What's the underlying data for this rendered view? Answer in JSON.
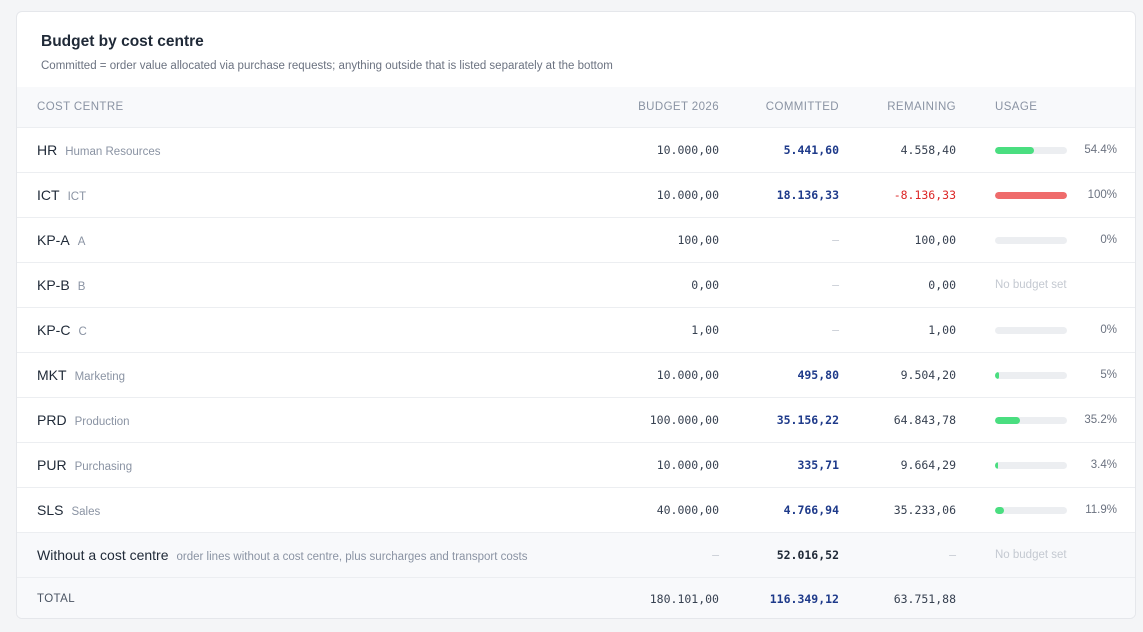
{
  "header": {
    "title": "Budget by cost centre",
    "subtitle": "Committed = order value allocated via purchase requests; anything outside that is listed separately at the bottom"
  },
  "columns": {
    "cost_centre": "COST CENTRE",
    "budget": "BUDGET 2026",
    "committed": "COMMITTED",
    "remaining": "REMAINING",
    "usage": "USAGE"
  },
  "colors": {
    "ok": "#4ade80",
    "over": "#ef6b6b",
    "track": "#eceef1"
  },
  "rows": [
    {
      "code": "HR",
      "description": "Human Resources",
      "budget": "10.000,00",
      "committed": "5.441,60",
      "remaining": "4.558,40",
      "usage_label": "54.4%",
      "usage_fraction": 0.544,
      "status": "ok"
    },
    {
      "code": "ICT",
      "description": "ICT",
      "budget": "10.000,00",
      "committed": "18.136,33",
      "remaining": "-8.136,33",
      "usage_label": "100%",
      "usage_fraction": 1.0,
      "status": "over"
    },
    {
      "code": "KP-A",
      "description": "A",
      "budget": "100,00",
      "committed": "–",
      "remaining": "100,00",
      "usage_label": "0%",
      "usage_fraction": 0.0,
      "status": "ok"
    },
    {
      "code": "KP-B",
      "description": "B",
      "budget": "0,00",
      "committed": "–",
      "remaining": "0,00",
      "usage_label": "No budget set",
      "usage_fraction": null,
      "status": "none"
    },
    {
      "code": "KP-C",
      "description": "C",
      "budget": "1,00",
      "committed": "–",
      "remaining": "1,00",
      "usage_label": "0%",
      "usage_fraction": 0.0,
      "status": "ok"
    },
    {
      "code": "MKT",
      "description": "Marketing",
      "budget": "10.000,00",
      "committed": "495,80",
      "remaining": "9.504,20",
      "usage_label": "5%",
      "usage_fraction": 0.05,
      "status": "ok"
    },
    {
      "code": "PRD",
      "description": "Production",
      "budget": "100.000,00",
      "committed": "35.156,22",
      "remaining": "64.843,78",
      "usage_label": "35.2%",
      "usage_fraction": 0.352,
      "status": "ok"
    },
    {
      "code": "PUR",
      "description": "Purchasing",
      "budget": "10.000,00",
      "committed": "335,71",
      "remaining": "9.664,29",
      "usage_label": "3.4%",
      "usage_fraction": 0.034,
      "status": "ok"
    },
    {
      "code": "SLS",
      "description": "Sales",
      "budget": "40.000,00",
      "committed": "4.766,94",
      "remaining": "35.233,06",
      "usage_label": "11.9%",
      "usage_fraction": 0.119,
      "status": "ok"
    }
  ],
  "unassigned": {
    "label": "Without a cost centre",
    "description": "order lines without a cost centre, plus surcharges and transport costs",
    "budget": "–",
    "committed": "52.016,52",
    "remaining": "–",
    "usage_label": "No budget set"
  },
  "total": {
    "label": "TOTAL",
    "budget": "180.101,00",
    "committed": "116.349,12",
    "remaining": "63.751,88"
  }
}
